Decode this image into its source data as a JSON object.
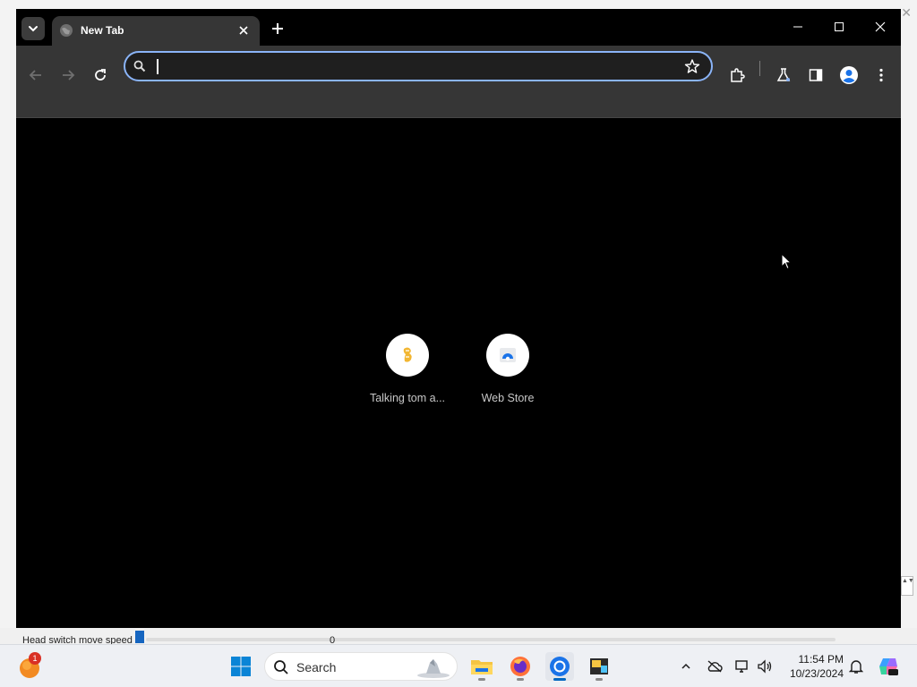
{
  "background_app": {
    "close_glyph": "✕",
    "label": "Head switch move speed",
    "slider_value": "0",
    "scroll_glyph": "▲▼"
  },
  "browser": {
    "tab": {
      "title": "New Tab",
      "favicon": "globe-icon"
    },
    "omnibox": {
      "value": "",
      "placeholder": ""
    },
    "toolbar_icons": [
      "back-icon",
      "forward-icon",
      "reload-icon",
      "star-icon",
      "extensions-icon",
      "labs-icon",
      "side-panel-icon",
      "profile-icon",
      "menu-icon"
    ],
    "window_controls": [
      "minimize-icon",
      "maximize-icon",
      "close-icon"
    ]
  },
  "new_tab_page": {
    "shortcuts": [
      {
        "label": "Talking tom a...",
        "icon": "talking-tom-icon"
      },
      {
        "label": "Web Store",
        "icon": "web-store-icon"
      }
    ]
  },
  "taskbar": {
    "weather_badge": "1",
    "search_placeholder": "Search",
    "apps": [
      "file-explorer-icon",
      "firefox-icon",
      "chrome-icon",
      "app-icon"
    ],
    "active_app": "chrome-icon",
    "tray_icons": [
      "chevron-up-icon",
      "onedrive-icon",
      "network-icon",
      "volume-icon"
    ],
    "time": "11:54 PM",
    "date": "10/23/2024"
  },
  "colors": {
    "omnibox_focus": "#8ab4f8",
    "toolbar_bg": "#363636",
    "ntp_bg": "#000000",
    "taskbar_bg": "#eef0f4",
    "accent": "#0067c0"
  }
}
